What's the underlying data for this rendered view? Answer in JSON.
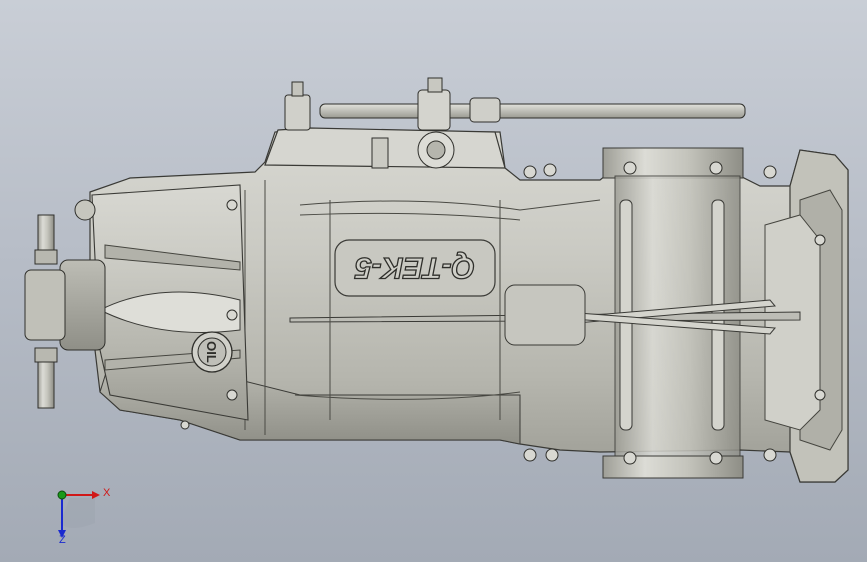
{
  "viewport": {
    "background_top": "#c9ced6",
    "background_bottom": "#a3aab5",
    "part_color": "#cfcfc8"
  },
  "model": {
    "casting_text": "Q-TEK-5",
    "oil_label": "OIL"
  },
  "triad": {
    "x_label": "X",
    "z_label": "Z",
    "x_color": "#d01818",
    "y_color": "#1a9a1a",
    "z_color": "#1a2ad0"
  }
}
